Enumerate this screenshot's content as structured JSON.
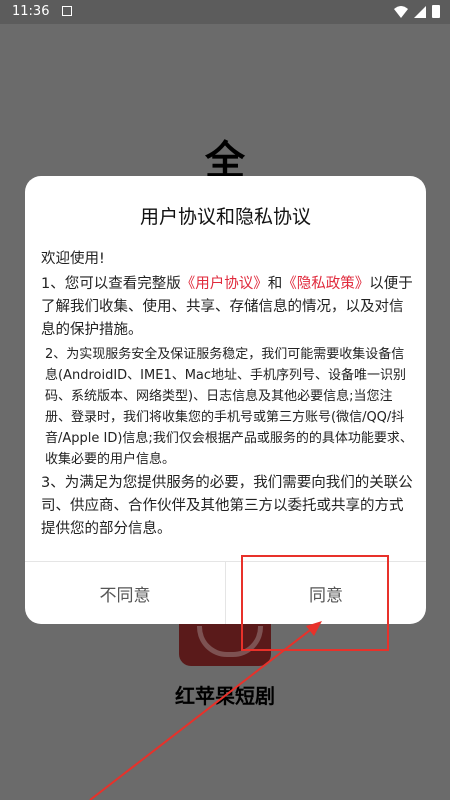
{
  "status_bar": {
    "time": "11:36"
  },
  "background": {
    "splash_title": "全",
    "app_name": "红苹果短剧"
  },
  "dialog": {
    "title": "用户协议和隐私协议",
    "welcome": "欢迎使用!",
    "p1_before": "1、您可以查看完整版",
    "p1_link1": "《用户协议》",
    "p1_mid": "和",
    "p1_link2": "《隐私政策》",
    "p1_after": "以便于了解我们收集、使用、共享、存储信息的情况，以及对信息的保护措施。",
    "p2": "2、为实现服务安全及保证服务稳定，我们可能需要收集设备信息(AndroidID、IME1、Mac地址、手机序列号、设备唯一识别码、系统版本、网络类型)、日志信息及其他必要信息;当您注册、登录时，我们将收集您的手机号或第三方账号(微信/QQ/抖音/Apple ID)信息;我们仅会根据产品或服务的的具体功能要求、收集必要的用户信息。",
    "p3": "3、为满足为您提供服务的必要，我们需要向我们的关联公司、供应商、合作伙伴及其他第三方以委托或共享的方式提供您的部分信息。",
    "disagree_label": "不同意",
    "agree_label": "同意"
  },
  "colors": {
    "link": "#e02a3c",
    "highlight": "#e8312a"
  }
}
